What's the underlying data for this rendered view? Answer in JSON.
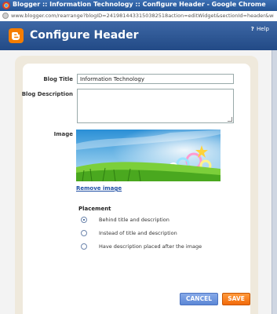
{
  "window": {
    "title": "Blogger :: Information Technology :: Configure Header - Google Chrome"
  },
  "address_bar": {
    "url": "www.blogger.com/rearrange?blogID=2419814433150382518action=editWidget&sectionId=header&widgetType"
  },
  "header": {
    "title": "Configure Header",
    "help_icon": "?",
    "help_label": "Help"
  },
  "form": {
    "blog_title_label": "Blog Title",
    "blog_title_value": "Information Technology",
    "blog_description_label": "Blog Description",
    "blog_description_value": "",
    "image_label": "Image",
    "remove_image_link": "Remove image",
    "placement_label": "Placement",
    "placement_options": [
      {
        "label": "Behind title and description",
        "selected": true
      },
      {
        "label": "Instead of title and description",
        "selected": false
      },
      {
        "label": "Have description placed after the image",
        "selected": false
      }
    ]
  },
  "buttons": {
    "cancel": "CANCEL",
    "save": "SAVE"
  },
  "colors": {
    "header_blue": "#2c5592",
    "save_orange": "#f57d00",
    "cancel_blue": "#6d95dc",
    "link_blue": "#1f4fa5"
  }
}
